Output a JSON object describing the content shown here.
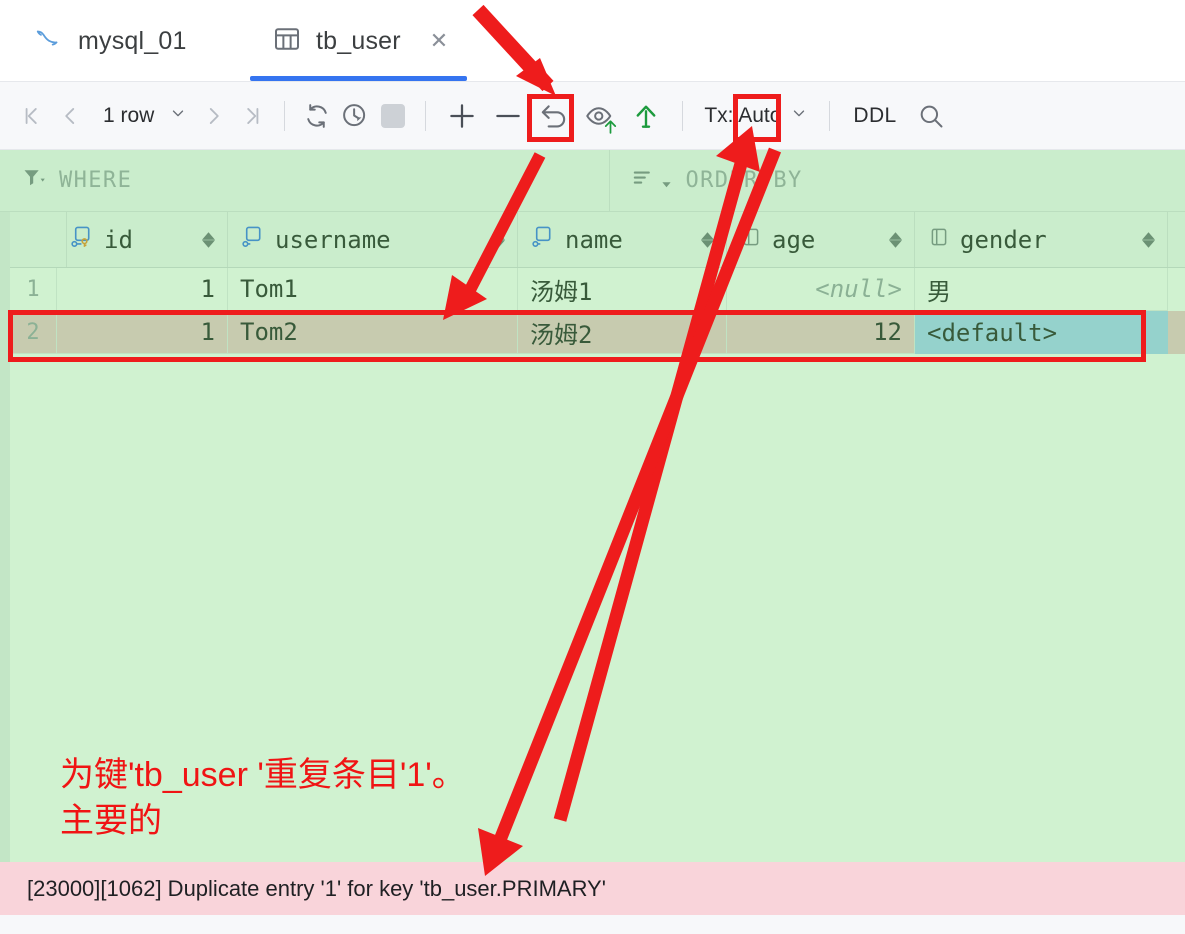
{
  "tabs": [
    {
      "label": "mysql_01",
      "icon": "mysql-dolphin-icon",
      "active": false
    },
    {
      "label": "tb_user",
      "icon": "table-icon",
      "active": true
    }
  ],
  "toolbar": {
    "first_page_icon": "first-page-icon",
    "prev_page_icon": "prev-page-icon",
    "row_count": "1 row",
    "row_count_chevron": "chevron-down-icon",
    "next_page_icon": "next-page-icon",
    "last_page_icon": "last-page-icon",
    "refresh_icon": "refresh-icon",
    "history_icon": "history-clock-icon",
    "stop_icon": "stop-icon",
    "add_row_icon": "plus-add-row-icon",
    "remove_row_icon": "minus-remove-row-icon",
    "revert_icon": "revert-undo-icon",
    "preview_icon": "preview-eye-upload-icon",
    "submit_icon": "submit-upload-arrow-icon",
    "tx_label": "Tx: Auto",
    "tx_chevron": "chevron-down-icon",
    "ddl_label": "DDL",
    "search_icon": "search-icon"
  },
  "filter": {
    "where_icon": "filter-funnel-icon",
    "where_label": "WHERE",
    "order_icon": "sort-lines-icon",
    "order_label": "ORDER BY"
  },
  "table": {
    "columns": [
      {
        "name": "id",
        "icon": "primary-key-column-icon"
      },
      {
        "name": "username",
        "icon": "text-column-icon"
      },
      {
        "name": "name",
        "icon": "text-column-icon"
      },
      {
        "name": "age",
        "icon": "numeric-column-icon"
      },
      {
        "name": "gender",
        "icon": "numeric-column-icon"
      }
    ],
    "rows": [
      {
        "number": "1",
        "state": "normal",
        "cells": [
          {
            "value": "1",
            "type": "number"
          },
          {
            "value": "Tom1",
            "type": "text"
          },
          {
            "value": "汤姆1",
            "type": "text"
          },
          {
            "value": "<null>",
            "type": "null"
          },
          {
            "value": "男",
            "type": "text"
          }
        ]
      },
      {
        "number": "2",
        "state": "error",
        "cells": [
          {
            "value": "1",
            "type": "number"
          },
          {
            "value": "Tom2",
            "type": "text"
          },
          {
            "value": "汤姆2",
            "type": "text"
          },
          {
            "value": "12",
            "type": "number"
          },
          {
            "value": "<default>",
            "type": "text",
            "selected": true
          }
        ]
      }
    ]
  },
  "error": {
    "message": "[23000][1062] Duplicate entry '1' for key 'tb_user.PRIMARY'"
  },
  "annotations": {
    "note_line1": "为键'tb_user '重复条目'1'。",
    "note_line2": "主要的",
    "highlight_color": "#ee1c1c",
    "note_color": "#f01414",
    "boxes": [
      {
        "name": "add-row-highlight"
      },
      {
        "name": "submit-highlight"
      },
      {
        "name": "error-row-highlight"
      }
    ]
  },
  "colors": {
    "accent_blue": "#3574f0",
    "selection_blue": "#a8d0fa",
    "error_row_pink": "#f2c6ce",
    "error_bar_pink": "#f9d4da",
    "green_overlay": "#c8ecc8",
    "toolbar_bg": "#f7f8fa"
  }
}
